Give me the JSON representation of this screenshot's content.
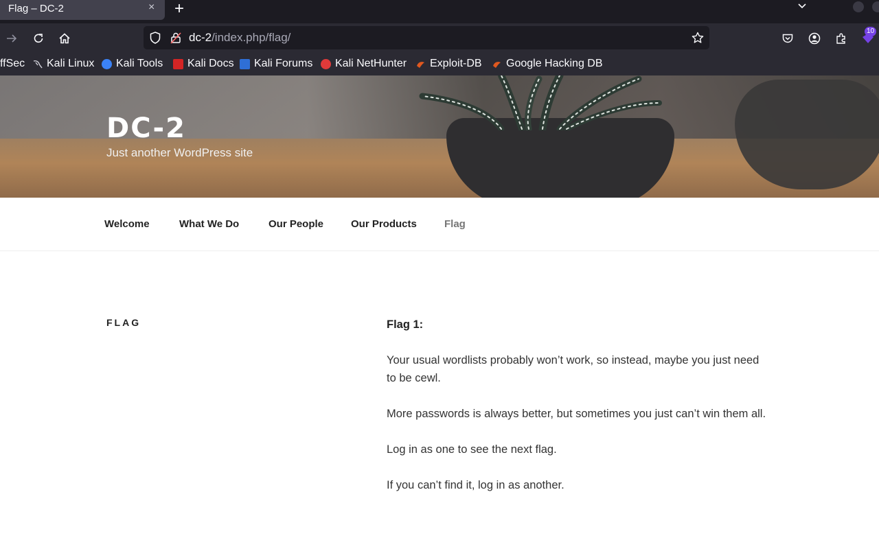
{
  "browser": {
    "tab_title": "Flag – DC-2",
    "tab_close": "×",
    "new_tab": "+",
    "url_host": "dc-2",
    "url_path": "/index.php/flag/",
    "extension_badge": "10"
  },
  "bookmarks": [
    {
      "label": "ffSec",
      "icon_color": "#2b2a33"
    },
    {
      "label": "Kali Linux",
      "icon_color": "#1a1a1a"
    },
    {
      "label": "Kali Tools",
      "icon_color": "#3b82f6"
    },
    {
      "label": "Kali Docs",
      "icon_color": "#d42525"
    },
    {
      "label": "Kali Forums",
      "icon_color": "#2f6fd6"
    },
    {
      "label": "Kali NetHunter",
      "icon_color": "#e03a3a"
    },
    {
      "label": "Exploit-DB",
      "icon_color": "#e0581f"
    },
    {
      "label": "Google Hacking DB",
      "icon_color": "#e0581f"
    }
  ],
  "site": {
    "title": "DC-2",
    "description": "Just another WordPress site"
  },
  "menu": [
    {
      "label": "Welcome"
    },
    {
      "label": "What We Do"
    },
    {
      "label": "Our People"
    },
    {
      "label": "Our Products"
    },
    {
      "label": "Flag"
    }
  ],
  "page": {
    "title": "FLAG",
    "heading": "Flag 1:",
    "paragraphs": [
      "Your usual wordlists probably won’t work, so instead, maybe you just need to be cewl.",
      "More passwords is always better, but sometimes you just can’t win them all.",
      "Log in as one to see the next flag.",
      "If you can’t find it, log in as another."
    ]
  }
}
